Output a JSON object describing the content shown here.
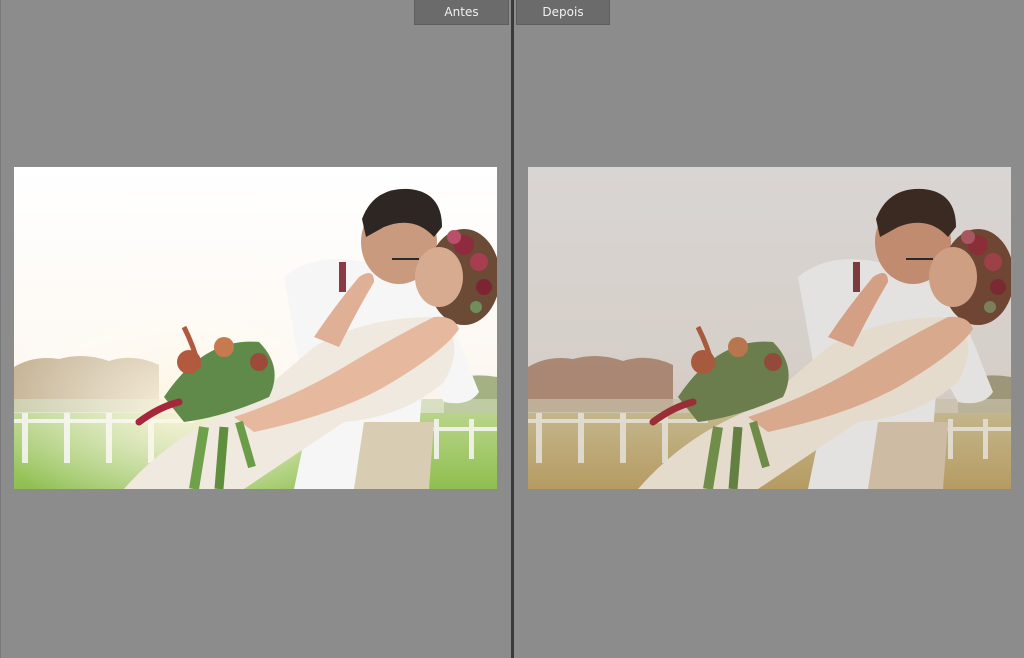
{
  "labels": {
    "before": "Antes",
    "after": "Depois"
  },
  "colors": {
    "background": "#8c8c8c",
    "divider": "#3a3a3a",
    "tab_background": "#6b6b6b",
    "tab_text": "#f0f0f0",
    "before_sky": "#ffffff",
    "after_sky": "#d6d3d1"
  }
}
